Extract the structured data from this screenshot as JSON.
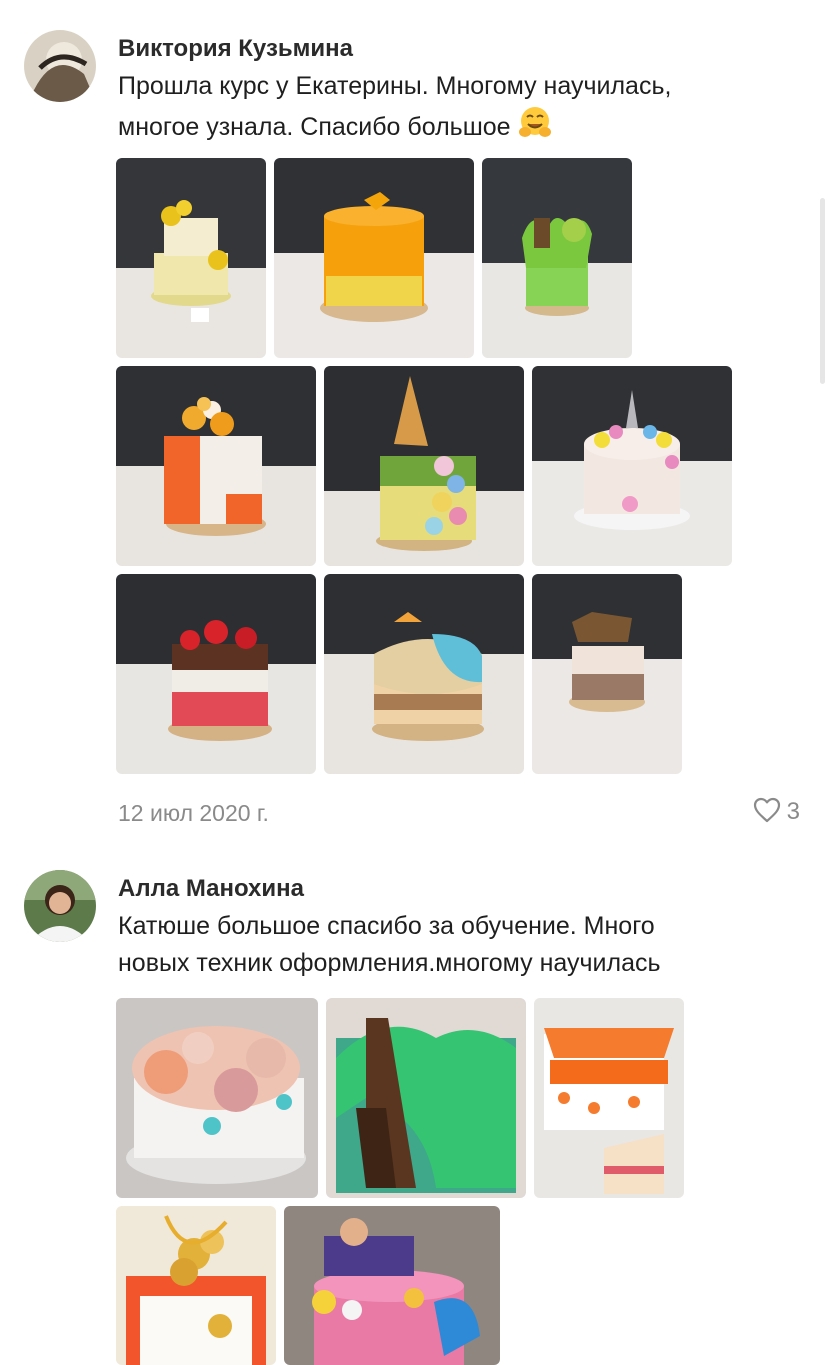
{
  "reviews": [
    {
      "author": "Виктория Кузьмина",
      "text_lines": [
        "Прошла курс у Екатерины. Многому научилась,",
        "многое узнала. Спасибо большое"
      ],
      "emoji": "hugging-face",
      "photos": [
        {
          "name": "yellow-flower-tier-cake"
        },
        {
          "name": "orange-cake"
        },
        {
          "name": "green-moss-cake"
        },
        {
          "name": "orange-white-cake"
        },
        {
          "name": "ice-cream-cone-cake"
        },
        {
          "name": "unicorn-cake"
        },
        {
          "name": "red-drip-cake"
        },
        {
          "name": "beach-cake"
        },
        {
          "name": "chocolate-topper-cake"
        }
      ],
      "date": "12 июл 2020 г.",
      "likes": "3"
    },
    {
      "author": "Алла Манохина",
      "text_lines": [
        "Катюше большое спасибо за обучение. Много",
        "новых техник оформления.многому научилась"
      ],
      "photos": [
        {
          "name": "rose-cake"
        },
        {
          "name": "green-bark-cake"
        },
        {
          "name": "angel-cake"
        },
        {
          "name": "gold-spheres-cake"
        },
        {
          "name": "aladdin-cake"
        }
      ]
    }
  ],
  "colors": {
    "heart": "#8a8a8a",
    "date": "#8a8a8a",
    "author": "#2b2b2b"
  }
}
